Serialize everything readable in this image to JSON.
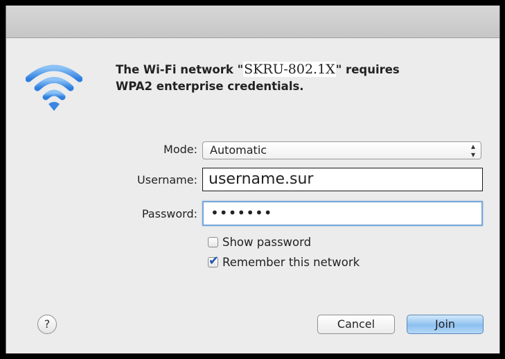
{
  "message": {
    "prefix": "The Wi-Fi network \"",
    "ssid": "SKRU-802.1X",
    "suffix": "\" requires",
    "line2": "WPA2 enterprise credentials."
  },
  "form": {
    "mode_label": "Mode:",
    "mode_value": "Automatic",
    "username_label": "Username:",
    "username_value": "username.sur",
    "password_label": "Password:",
    "password_value": "•••••••"
  },
  "options": {
    "show_password": {
      "label": "Show password",
      "checked": false
    },
    "remember_network": {
      "label": "Remember this network",
      "checked": true
    }
  },
  "buttons": {
    "help": "?",
    "cancel": "Cancel",
    "join": "Join"
  },
  "icons": {
    "wifi": "wifi-icon",
    "select_arrows": "up-down-arrows-icon",
    "check": "checkmark-icon"
  },
  "colors": {
    "wifi_blue": "#3d8ae3",
    "focus_ring": "#78a6d8",
    "default_button": "#8cc0f0"
  }
}
